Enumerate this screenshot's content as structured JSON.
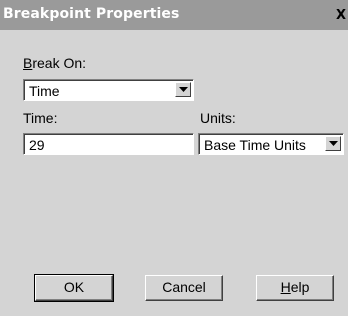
{
  "window": {
    "title": "Breakpoint Properties",
    "close_glyph": "X"
  },
  "break_on": {
    "label_mnemonic": "B",
    "label_rest": "reak On:",
    "selected": "Time"
  },
  "time": {
    "label": "Time:",
    "value": "29"
  },
  "units": {
    "label": "Units:",
    "selected": "Base Time Units"
  },
  "buttons": {
    "ok": "OK",
    "cancel": "Cancel",
    "help_mnemonic": "H",
    "help_rest": "elp"
  }
}
